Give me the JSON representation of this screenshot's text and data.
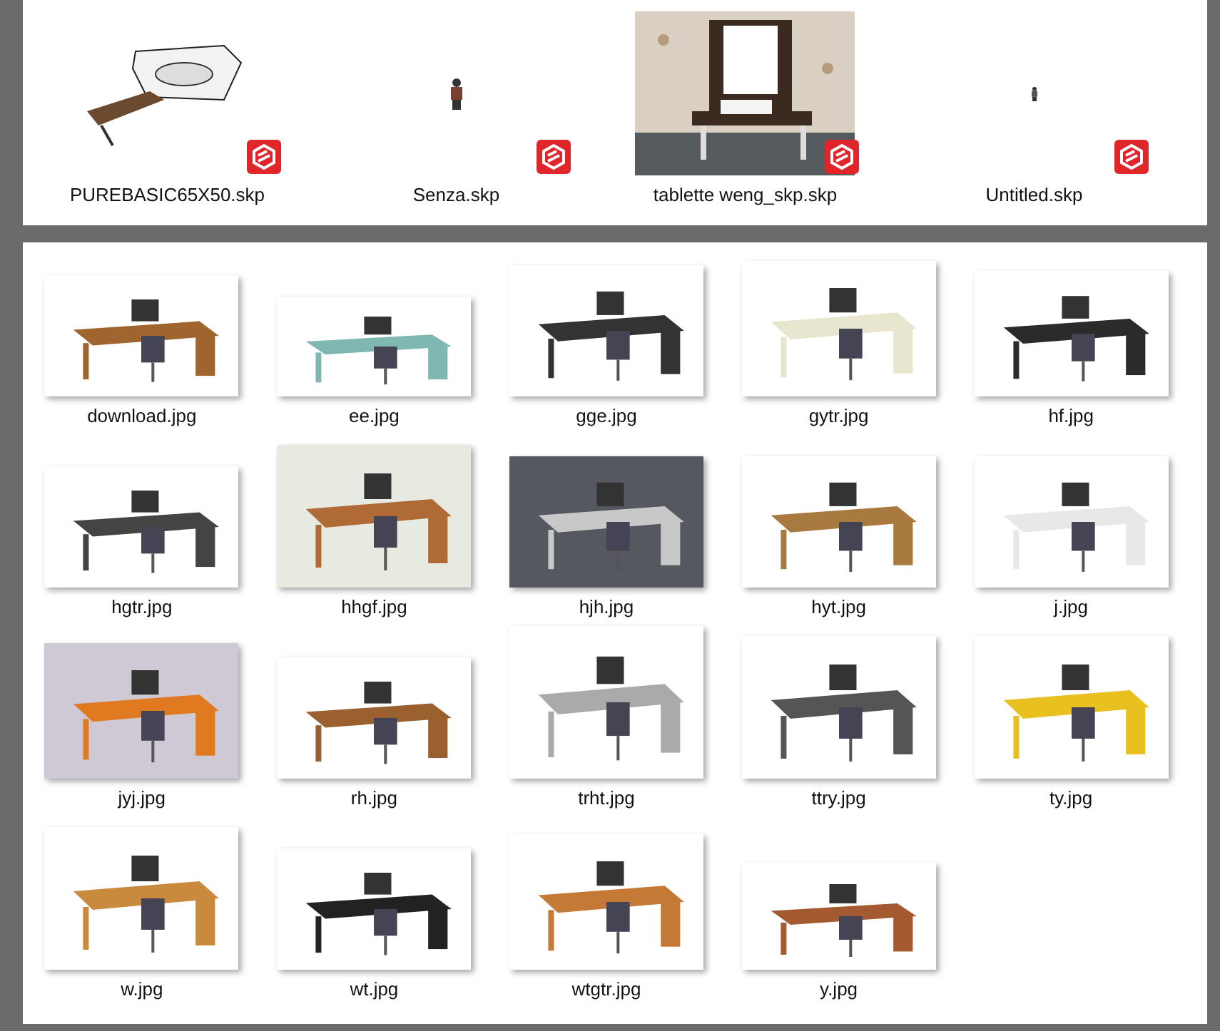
{
  "sketchup_files": [
    {
      "name": "PUREBASIC65X50.skp"
    },
    {
      "name": "Senza.skp"
    },
    {
      "name": "tablette weng_skp.skp"
    },
    {
      "name": "Untitled.skp"
    }
  ],
  "image_files": [
    {
      "name": "download.jpg"
    },
    {
      "name": "ee.jpg"
    },
    {
      "name": "gge.jpg"
    },
    {
      "name": "gytr.jpg"
    },
    {
      "name": "hf.jpg"
    },
    {
      "name": "hgtr.jpg"
    },
    {
      "name": "hhgf.jpg"
    },
    {
      "name": "hjh.jpg"
    },
    {
      "name": "hyt.jpg"
    },
    {
      "name": "j.jpg"
    },
    {
      "name": "jyj.jpg"
    },
    {
      "name": "rh.jpg"
    },
    {
      "name": "trht.jpg"
    },
    {
      "name": "ttry.jpg"
    },
    {
      "name": "ty.jpg"
    },
    {
      "name": "w.jpg"
    },
    {
      "name": "wt.jpg"
    },
    {
      "name": "wtgtr.jpg"
    },
    {
      "name": "y.jpg"
    }
  ]
}
